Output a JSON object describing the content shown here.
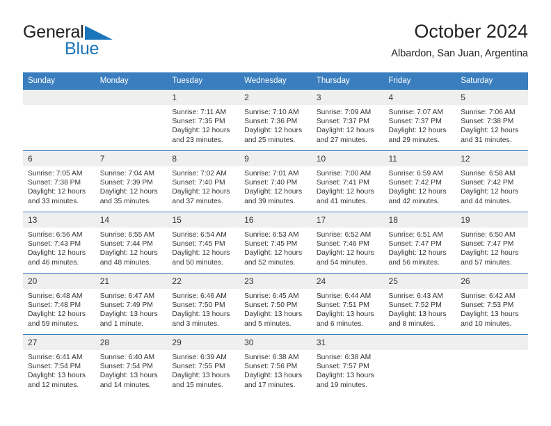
{
  "brand": {
    "name_part1": "General",
    "name_part2": "Blue",
    "triangle_icon": "triangle-icon",
    "accent_color": "#1b75bb"
  },
  "header": {
    "title": "October 2024",
    "subtitle": "Albardon, San Juan, Argentina"
  },
  "theme": {
    "header_row_bg": "#3a7ebf",
    "daynum_bg": "#efefef",
    "grid_line": "#3a7ebf",
    "text": "#333333"
  },
  "weekdays": [
    "Sunday",
    "Monday",
    "Tuesday",
    "Wednesday",
    "Thursday",
    "Friday",
    "Saturday"
  ],
  "weeks": [
    [
      {
        "day": "",
        "sunrise": "",
        "sunset": "",
        "daylight_line1": "",
        "daylight_line2": ""
      },
      {
        "day": "",
        "sunrise": "",
        "sunset": "",
        "daylight_line1": "",
        "daylight_line2": ""
      },
      {
        "day": "1",
        "sunrise": "Sunrise: 7:11 AM",
        "sunset": "Sunset: 7:35 PM",
        "daylight_line1": "Daylight: 12 hours",
        "daylight_line2": "and 23 minutes."
      },
      {
        "day": "2",
        "sunrise": "Sunrise: 7:10 AM",
        "sunset": "Sunset: 7:36 PM",
        "daylight_line1": "Daylight: 12 hours",
        "daylight_line2": "and 25 minutes."
      },
      {
        "day": "3",
        "sunrise": "Sunrise: 7:09 AM",
        "sunset": "Sunset: 7:37 PM",
        "daylight_line1": "Daylight: 12 hours",
        "daylight_line2": "and 27 minutes."
      },
      {
        "day": "4",
        "sunrise": "Sunrise: 7:07 AM",
        "sunset": "Sunset: 7:37 PM",
        "daylight_line1": "Daylight: 12 hours",
        "daylight_line2": "and 29 minutes."
      },
      {
        "day": "5",
        "sunrise": "Sunrise: 7:06 AM",
        "sunset": "Sunset: 7:38 PM",
        "daylight_line1": "Daylight: 12 hours",
        "daylight_line2": "and 31 minutes."
      }
    ],
    [
      {
        "day": "6",
        "sunrise": "Sunrise: 7:05 AM",
        "sunset": "Sunset: 7:38 PM",
        "daylight_line1": "Daylight: 12 hours",
        "daylight_line2": "and 33 minutes."
      },
      {
        "day": "7",
        "sunrise": "Sunrise: 7:04 AM",
        "sunset": "Sunset: 7:39 PM",
        "daylight_line1": "Daylight: 12 hours",
        "daylight_line2": "and 35 minutes."
      },
      {
        "day": "8",
        "sunrise": "Sunrise: 7:02 AM",
        "sunset": "Sunset: 7:40 PM",
        "daylight_line1": "Daylight: 12 hours",
        "daylight_line2": "and 37 minutes."
      },
      {
        "day": "9",
        "sunrise": "Sunrise: 7:01 AM",
        "sunset": "Sunset: 7:40 PM",
        "daylight_line1": "Daylight: 12 hours",
        "daylight_line2": "and 39 minutes."
      },
      {
        "day": "10",
        "sunrise": "Sunrise: 7:00 AM",
        "sunset": "Sunset: 7:41 PM",
        "daylight_line1": "Daylight: 12 hours",
        "daylight_line2": "and 41 minutes."
      },
      {
        "day": "11",
        "sunrise": "Sunrise: 6:59 AM",
        "sunset": "Sunset: 7:42 PM",
        "daylight_line1": "Daylight: 12 hours",
        "daylight_line2": "and 42 minutes."
      },
      {
        "day": "12",
        "sunrise": "Sunrise: 6:58 AM",
        "sunset": "Sunset: 7:42 PM",
        "daylight_line1": "Daylight: 12 hours",
        "daylight_line2": "and 44 minutes."
      }
    ],
    [
      {
        "day": "13",
        "sunrise": "Sunrise: 6:56 AM",
        "sunset": "Sunset: 7:43 PM",
        "daylight_line1": "Daylight: 12 hours",
        "daylight_line2": "and 46 minutes."
      },
      {
        "day": "14",
        "sunrise": "Sunrise: 6:55 AM",
        "sunset": "Sunset: 7:44 PM",
        "daylight_line1": "Daylight: 12 hours",
        "daylight_line2": "and 48 minutes."
      },
      {
        "day": "15",
        "sunrise": "Sunrise: 6:54 AM",
        "sunset": "Sunset: 7:45 PM",
        "daylight_line1": "Daylight: 12 hours",
        "daylight_line2": "and 50 minutes."
      },
      {
        "day": "16",
        "sunrise": "Sunrise: 6:53 AM",
        "sunset": "Sunset: 7:45 PM",
        "daylight_line1": "Daylight: 12 hours",
        "daylight_line2": "and 52 minutes."
      },
      {
        "day": "17",
        "sunrise": "Sunrise: 6:52 AM",
        "sunset": "Sunset: 7:46 PM",
        "daylight_line1": "Daylight: 12 hours",
        "daylight_line2": "and 54 minutes."
      },
      {
        "day": "18",
        "sunrise": "Sunrise: 6:51 AM",
        "sunset": "Sunset: 7:47 PM",
        "daylight_line1": "Daylight: 12 hours",
        "daylight_line2": "and 56 minutes."
      },
      {
        "day": "19",
        "sunrise": "Sunrise: 6:50 AM",
        "sunset": "Sunset: 7:47 PM",
        "daylight_line1": "Daylight: 12 hours",
        "daylight_line2": "and 57 minutes."
      }
    ],
    [
      {
        "day": "20",
        "sunrise": "Sunrise: 6:48 AM",
        "sunset": "Sunset: 7:48 PM",
        "daylight_line1": "Daylight: 12 hours",
        "daylight_line2": "and 59 minutes."
      },
      {
        "day": "21",
        "sunrise": "Sunrise: 6:47 AM",
        "sunset": "Sunset: 7:49 PM",
        "daylight_line1": "Daylight: 13 hours",
        "daylight_line2": "and 1 minute."
      },
      {
        "day": "22",
        "sunrise": "Sunrise: 6:46 AM",
        "sunset": "Sunset: 7:50 PM",
        "daylight_line1": "Daylight: 13 hours",
        "daylight_line2": "and 3 minutes."
      },
      {
        "day": "23",
        "sunrise": "Sunrise: 6:45 AM",
        "sunset": "Sunset: 7:50 PM",
        "daylight_line1": "Daylight: 13 hours",
        "daylight_line2": "and 5 minutes."
      },
      {
        "day": "24",
        "sunrise": "Sunrise: 6:44 AM",
        "sunset": "Sunset: 7:51 PM",
        "daylight_line1": "Daylight: 13 hours",
        "daylight_line2": "and 6 minutes."
      },
      {
        "day": "25",
        "sunrise": "Sunrise: 6:43 AM",
        "sunset": "Sunset: 7:52 PM",
        "daylight_line1": "Daylight: 13 hours",
        "daylight_line2": "and 8 minutes."
      },
      {
        "day": "26",
        "sunrise": "Sunrise: 6:42 AM",
        "sunset": "Sunset: 7:53 PM",
        "daylight_line1": "Daylight: 13 hours",
        "daylight_line2": "and 10 minutes."
      }
    ],
    [
      {
        "day": "27",
        "sunrise": "Sunrise: 6:41 AM",
        "sunset": "Sunset: 7:54 PM",
        "daylight_line1": "Daylight: 13 hours",
        "daylight_line2": "and 12 minutes."
      },
      {
        "day": "28",
        "sunrise": "Sunrise: 6:40 AM",
        "sunset": "Sunset: 7:54 PM",
        "daylight_line1": "Daylight: 13 hours",
        "daylight_line2": "and 14 minutes."
      },
      {
        "day": "29",
        "sunrise": "Sunrise: 6:39 AM",
        "sunset": "Sunset: 7:55 PM",
        "daylight_line1": "Daylight: 13 hours",
        "daylight_line2": "and 15 minutes."
      },
      {
        "day": "30",
        "sunrise": "Sunrise: 6:38 AM",
        "sunset": "Sunset: 7:56 PM",
        "daylight_line1": "Daylight: 13 hours",
        "daylight_line2": "and 17 minutes."
      },
      {
        "day": "31",
        "sunrise": "Sunrise: 6:38 AM",
        "sunset": "Sunset: 7:57 PM",
        "daylight_line1": "Daylight: 13 hours",
        "daylight_line2": "and 19 minutes."
      },
      {
        "day": "",
        "sunrise": "",
        "sunset": "",
        "daylight_line1": "",
        "daylight_line2": ""
      },
      {
        "day": "",
        "sunrise": "",
        "sunset": "",
        "daylight_line1": "",
        "daylight_line2": ""
      }
    ]
  ]
}
